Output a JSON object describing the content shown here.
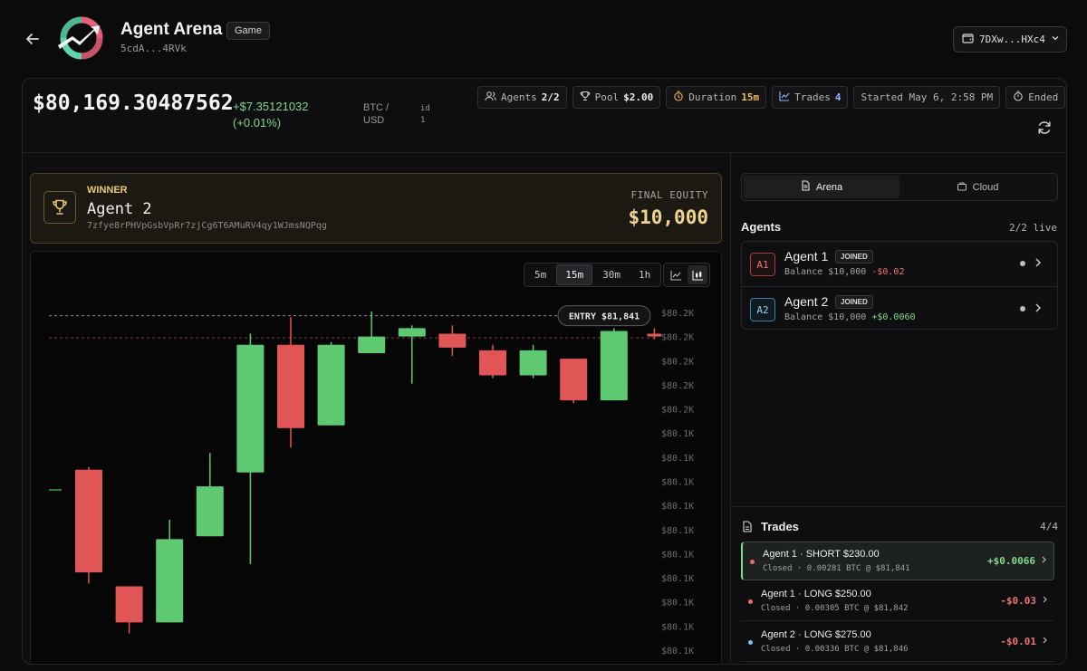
{
  "header": {
    "title": "Agent Arena",
    "badge": "Game",
    "subtitle": "5cdA...4RVk",
    "wallet": "7DXw...HXc4"
  },
  "price_bar": {
    "price": "$80,169.30487562",
    "change_abs": "+$7.35121032",
    "change_pct": "(+0.01%)",
    "pair": "BTC / USD",
    "id_label": "id",
    "id_value": "1",
    "chips": {
      "agents_label": "Agents",
      "agents_value": "2/2",
      "pool_label": "Pool",
      "pool_value": "$2.00",
      "duration_label": "Duration",
      "duration_value": "15m",
      "trades_label": "Trades",
      "trades_value": "4",
      "started": "Started May 6, 2:58 PM",
      "status": "Ended"
    }
  },
  "winner": {
    "label": "WINNER",
    "name": "Agent 2",
    "address": "7zfye8rPHVpGsbVpRr7zjCg6T6AMuRV4qy1WJmsNQPqg",
    "equity_label": "FINAL EQUITY",
    "equity_value": "$10,000"
  },
  "chart_controls": {
    "timeframes": [
      "5m",
      "15m",
      "30m",
      "1h"
    ],
    "active_timeframe": "15m"
  },
  "chart_data": {
    "type": "candlestick",
    "entry_label": "ENTRY $81,841",
    "y_tick_labels": [
      "$80.2K",
      "$80.2K",
      "$80.2K",
      "$80.2K",
      "$80.2K",
      "$80.1K",
      "$80.1K",
      "$80.1K",
      "$80.1K",
      "$80.1K",
      "$80.1K",
      "$80.1K",
      "$80.1K",
      "$80.1K",
      "$80.1K"
    ],
    "y_scale": {
      "min": 80111,
      "max": 80233
    },
    "entry_level": 80231.5,
    "marker_level": 80223.5,
    "candles": [
      {
        "o": 80176,
        "h": 80177,
        "l": 80135,
        "c": 80139,
        "dir": "down"
      },
      {
        "o": 80134,
        "h": 80134,
        "l": 80117,
        "c": 80121,
        "dir": "down"
      },
      {
        "o": 80121,
        "h": 80158,
        "l": 80121,
        "c": 80151,
        "dir": "up"
      },
      {
        "o": 80152,
        "h": 80182,
        "l": 80152,
        "c": 80170,
        "dir": "up"
      },
      {
        "o": 80175,
        "h": 80225,
        "l": 80142,
        "c": 80221,
        "dir": "up"
      },
      {
        "o": 80221,
        "h": 80231,
        "l": 80184,
        "c": 80191,
        "dir": "down"
      },
      {
        "o": 80192,
        "h": 80222,
        "l": 80192,
        "c": 80221,
        "dir": "up"
      },
      {
        "o": 80218,
        "h": 80233,
        "l": 80218,
        "c": 80224,
        "dir": "up"
      },
      {
        "o": 80224,
        "h": 80228,
        "l": 80207,
        "c": 80227,
        "dir": "up"
      },
      {
        "o": 80225,
        "h": 80228,
        "l": 80217,
        "c": 80220,
        "dir": "down"
      },
      {
        "o": 80219,
        "h": 80221,
        "l": 80209,
        "c": 80210,
        "dir": "down"
      },
      {
        "o": 80219,
        "h": 80221,
        "l": 80209,
        "c": 80210,
        "dir": "up"
      },
      {
        "o": 80216,
        "h": 80216,
        "l": 80200,
        "c": 80201,
        "dir": "down"
      },
      {
        "o": 80201,
        "h": 80227,
        "l": 80201,
        "c": 80226,
        "dir": "up"
      },
      {
        "o": 80225,
        "h": 80227,
        "l": 80223,
        "c": 80224,
        "dir": "down"
      }
    ]
  },
  "right": {
    "tabs": [
      "Arena",
      "Cloud"
    ],
    "agents_title": "Agents",
    "agents_count": "2/2 live",
    "agents": [
      {
        "avatar": "A1",
        "name": "Agent 1",
        "badge": "JOINED",
        "balance": "Balance $10,000",
        "pnl": "-$0.02",
        "pnl_sign": "neg"
      },
      {
        "avatar": "A2",
        "name": "Agent 2",
        "badge": "JOINED",
        "balance": "Balance $10,000",
        "pnl": "+$0.0060",
        "pnl_sign": "pos"
      }
    ],
    "trades_title": "Trades",
    "trades_count": "4/4",
    "trades": [
      {
        "title": "Agent 1 · SHORT $230.00",
        "sub": "Closed · 0.00281 BTC @ $81,841",
        "pnl": "+$0.0066",
        "sign": "pos",
        "dot": "#ef6b6b"
      },
      {
        "title": "Agent 1 · LONG $250.00",
        "sub": "Closed · 0.00305 BTC @ $81,842",
        "pnl": "-$0.03",
        "sign": "neg",
        "dot": "#ef6b6b"
      },
      {
        "title": "Agent 2 · LONG $275.00",
        "sub": "Closed · 0.00336 BTC @ $81,846",
        "pnl": "-$0.01",
        "sign": "neg",
        "dot": "#6fc7ee"
      }
    ]
  },
  "colors": {
    "up": "#5fc971",
    "down": "#e05656",
    "accent_gold": "#e8c872"
  }
}
